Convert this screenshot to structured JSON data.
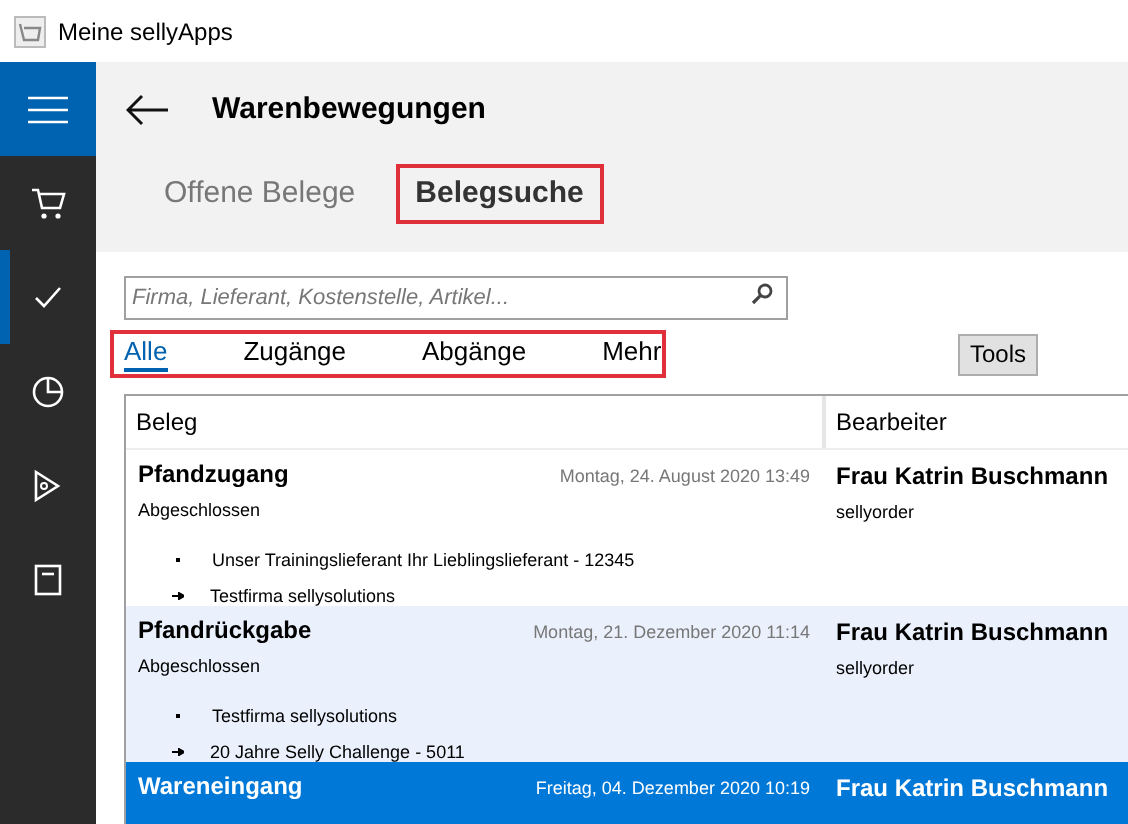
{
  "window": {
    "title": "Meine sellyApps"
  },
  "sidebar": {
    "items": [
      {
        "selected": false
      },
      {
        "selected": true
      },
      {
        "selected": false
      },
      {
        "selected": false
      },
      {
        "selected": false
      }
    ]
  },
  "header": {
    "title": "Warenbewegungen"
  },
  "tabs": [
    {
      "label": "Offene Belege",
      "selected": false,
      "highlighted": false
    },
    {
      "label": "Belegsuche",
      "selected": true,
      "highlighted": true
    }
  ],
  "search": {
    "placeholder": "Firma, Lieferant, Kostenstelle, Artikel..."
  },
  "filters": [
    {
      "label": "Alle",
      "selected": true
    },
    {
      "label": "Zugänge",
      "selected": false
    },
    {
      "label": "Abgänge",
      "selected": false
    },
    {
      "label": "Mehr",
      "selected": false
    }
  ],
  "tools_button": "Tools",
  "table": {
    "columns": [
      "Beleg",
      "Bearbeiter"
    ],
    "rows": [
      {
        "title": "Pfandzugang",
        "date": "Montag, 24. August 2020 13:49",
        "status": "Abgeschlossen",
        "from": "Unser Trainingslieferant Ihr Lieblingslieferant - 12345",
        "to": "Testfirma sellysolutions",
        "user": "Frau Katrin Buschmann",
        "app": "sellyorder",
        "selected": false
      },
      {
        "title": "Pfandrückgabe",
        "date": "Montag, 21. Dezember 2020 11:14",
        "status": "Abgeschlossen",
        "from": "Testfirma sellysolutions",
        "to": "20 Jahre Selly Challenge - 5011",
        "user": "Frau Katrin Buschmann",
        "app": "sellyorder",
        "selected": false
      },
      {
        "title": "Wareneingang",
        "date": "Freitag, 04. Dezember 2020 10:19",
        "user": "Frau Katrin Buschmann",
        "selected": true
      }
    ]
  }
}
